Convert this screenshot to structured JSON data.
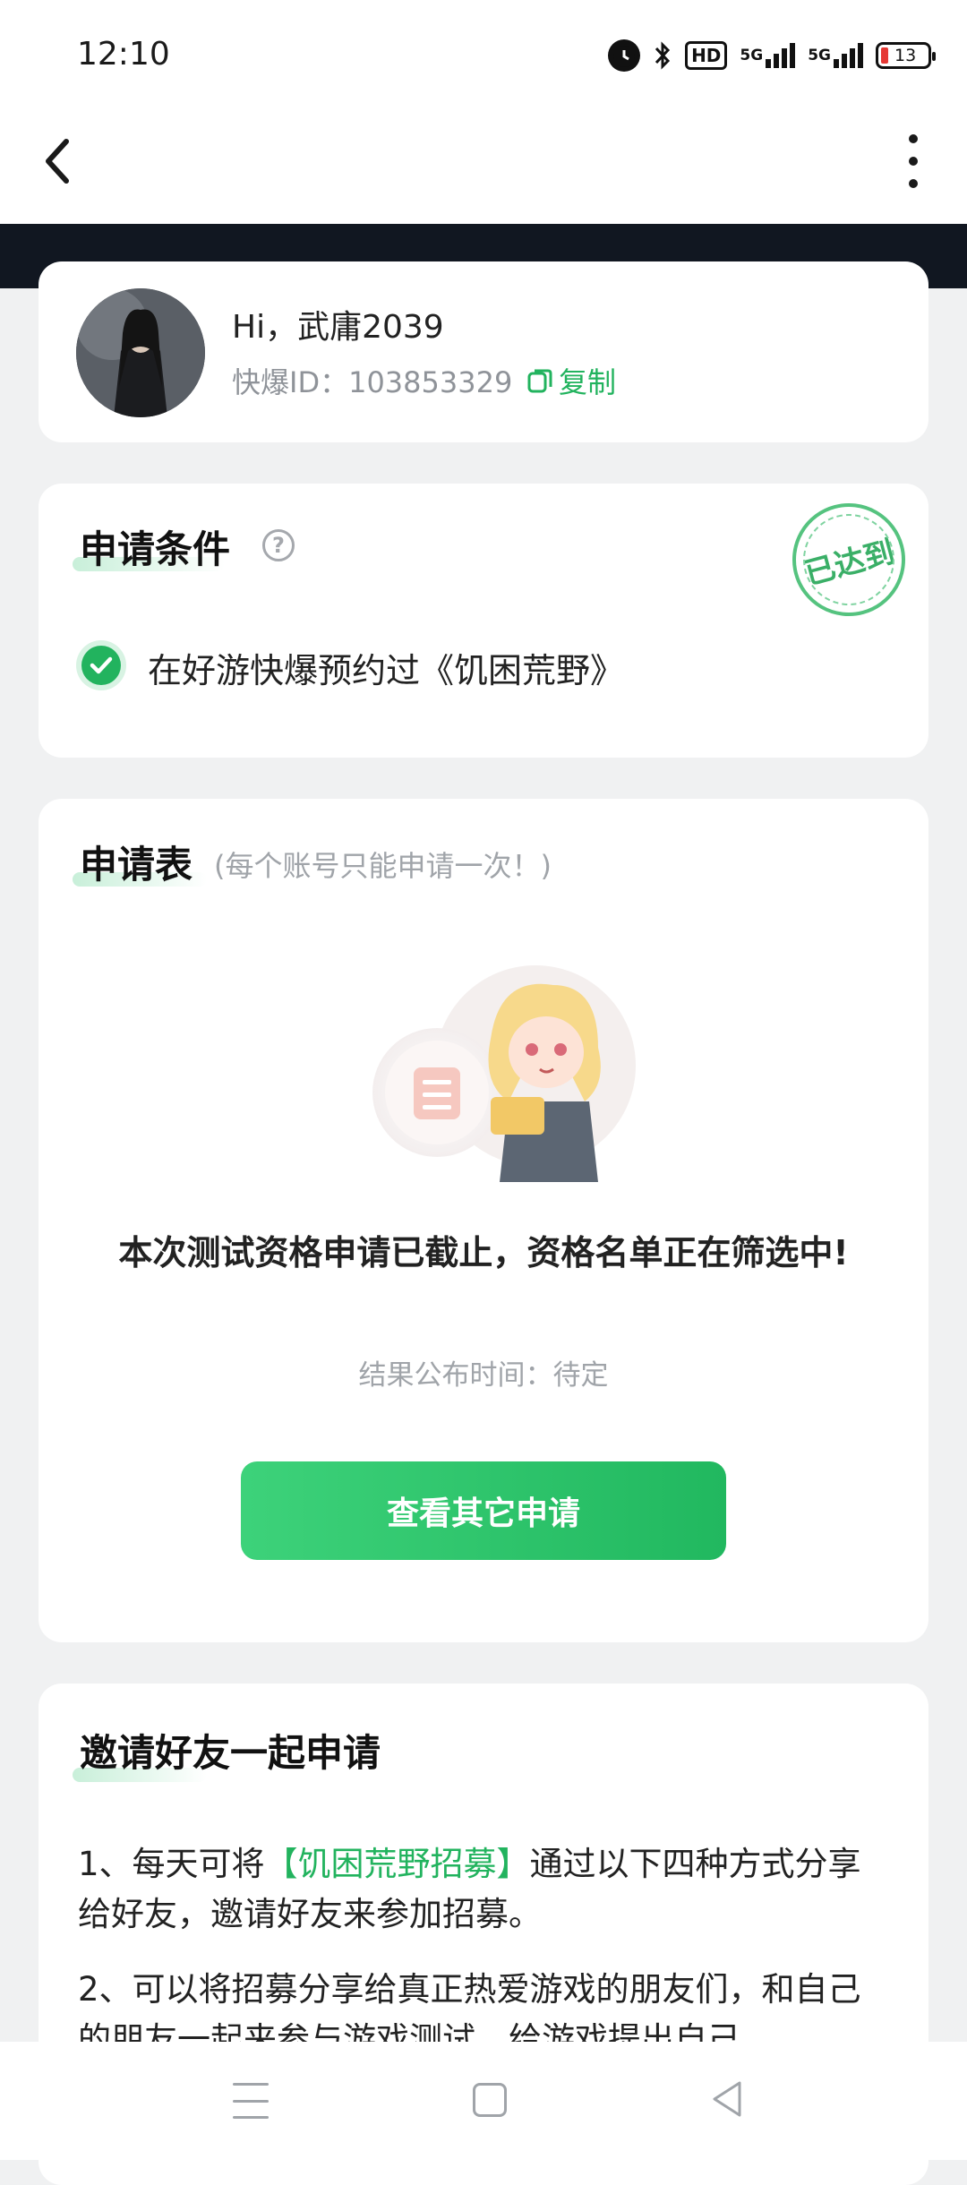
{
  "status_bar": {
    "time": "12:10",
    "hd_label": "HD",
    "signal1_label": "5G",
    "signal2_label": "5G",
    "battery_level": "13"
  },
  "profile": {
    "greeting": "Hi，武庸2039",
    "id_text": "快爆ID：103853329",
    "copy_label": "复制"
  },
  "conditions": {
    "title": "申请条件",
    "help_symbol": "?",
    "stamp_text": "已达到",
    "items": [
      {
        "text": "在好游快爆预约过《饥困荒野》"
      }
    ]
  },
  "form": {
    "title": "申请表",
    "note": "(每个账号只能申请一次！)",
    "closed_message": "本次测试资格申请已截止，资格名单正在筛选中!",
    "publish_time": "结果公布时间：待定",
    "button_label": "查看其它申请"
  },
  "invite": {
    "title": "邀请好友一起申请",
    "rule1_prefix": "1、每天可将",
    "rule1_highlight": "【饥困荒野招募】",
    "rule1_suffix": "通过以下四种方式分享给好友，邀请好友来参加招募。",
    "rule2": "2、可以将招募分享给真正热爱游戏的朋友们，和自己的朋友一起来参与游戏测试，给游戏提出自己"
  },
  "colors": {
    "accent": "#22b35e",
    "background": "#f0f1f2",
    "dark_band": "#111721"
  }
}
